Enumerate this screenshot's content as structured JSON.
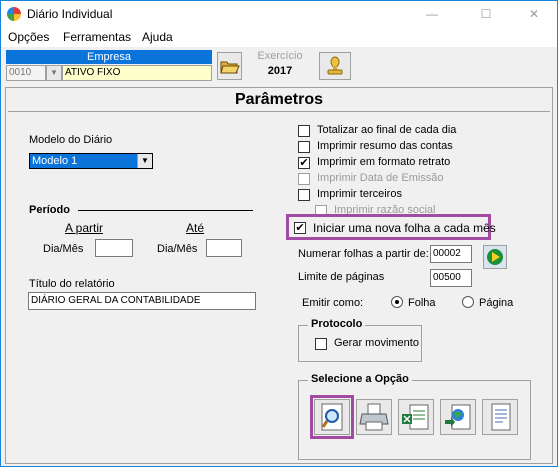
{
  "window": {
    "title": "Diário Individual",
    "minimize": "—",
    "maximize": "☐",
    "close": "✕"
  },
  "menu": [
    {
      "label": "Opções"
    },
    {
      "label": "Ferramentas"
    },
    {
      "label": "Ajuda"
    }
  ],
  "empresa": {
    "header": "Empresa",
    "code": "0010",
    "name": "ATIVO FIXO"
  },
  "exercicio": {
    "label": "Exercício",
    "year": "2017"
  },
  "panel_title": "Parâmetros",
  "modelo": {
    "label": "Modelo do Diário",
    "value": "Modelo 1"
  },
  "periodo": {
    "label": "Período",
    "from": "A partir",
    "to": "Até",
    "dm1": "Dia/Mês",
    "dm2": "Dia/Mês",
    "from_value": "",
    "to_value": ""
  },
  "titulo": {
    "label": "Título do relatório",
    "value": "DIÁRIO GERAL DA CONTABILIDADE"
  },
  "checkboxes": [
    {
      "label": "Totalizar ao final de cada dia",
      "checked": false,
      "enabled": true
    },
    {
      "label": "Imprimir resumo das contas",
      "checked": false,
      "enabled": true
    },
    {
      "label": "Imprimir em formato retrato",
      "checked": true,
      "enabled": true
    },
    {
      "label": "Imprimir Data de Emissão",
      "checked": false,
      "enabled": false
    },
    {
      "label": "Imprimir terceiros",
      "checked": false,
      "enabled": true
    },
    {
      "label": "Imprimir razão social",
      "checked": false,
      "enabled": false
    },
    {
      "label": "Iniciar uma nova folha a cada mês",
      "checked": true,
      "enabled": true
    }
  ],
  "numerar": {
    "label": "Numerar folhas a partir de:",
    "value": "00002"
  },
  "limite": {
    "label": "Limite de páginas",
    "value": "00500"
  },
  "emitir": {
    "label": "Emitir como:",
    "opt1": "Folha",
    "opt2": "Página",
    "selected": "Folha"
  },
  "protocolo": {
    "title": "Protocolo",
    "checkbox": "Gerar movimento",
    "checked": false
  },
  "opcoes": {
    "title": "Selecione a Opção",
    "buttons": [
      "preview-icon",
      "printer-icon",
      "excel-export-icon",
      "web-export-icon",
      "text-export-icon"
    ]
  },
  "colors": {
    "accent": "#0a74da",
    "highlight": "#a34ba3",
    "name_bg": "#ffffcc"
  }
}
